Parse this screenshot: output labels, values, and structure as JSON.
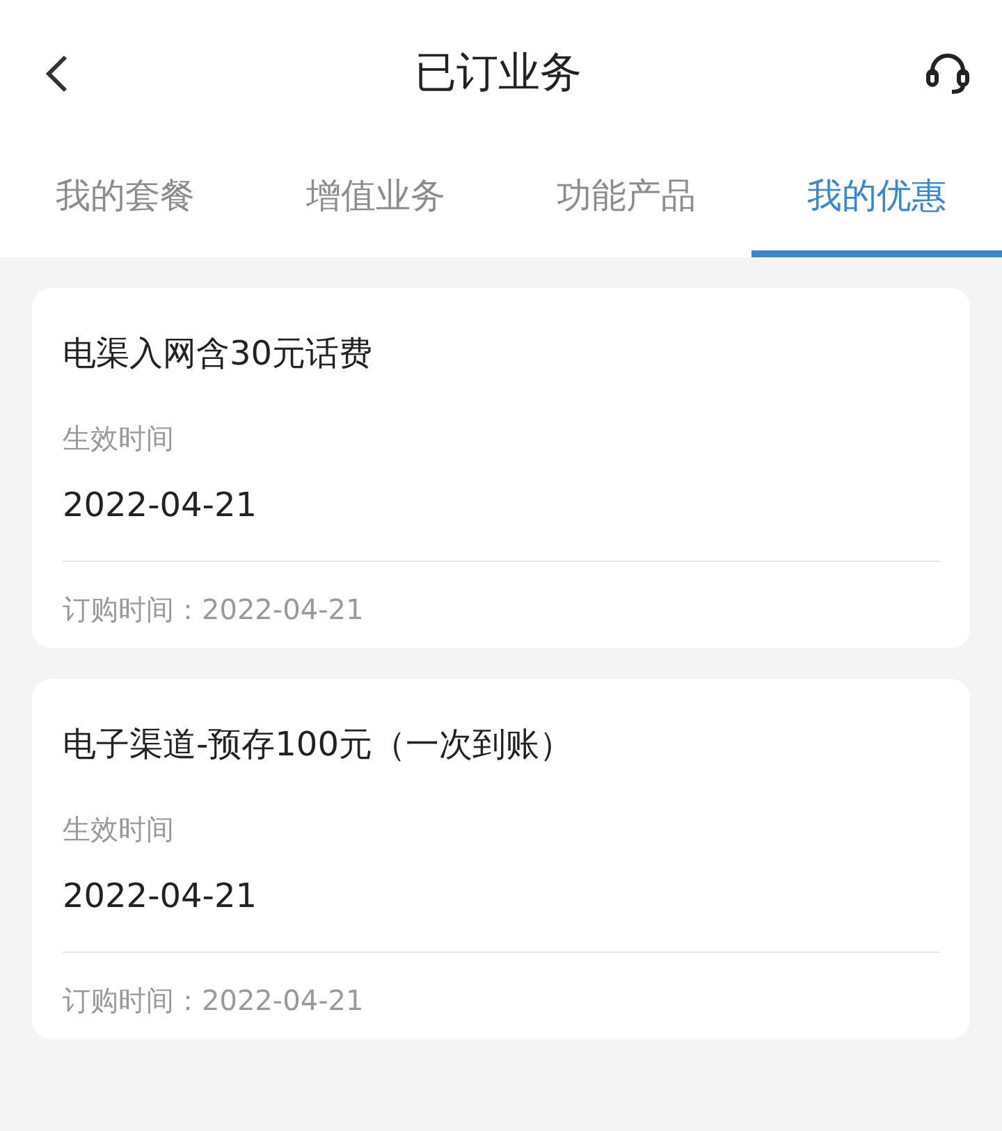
{
  "header": {
    "title": "已订业务"
  },
  "tabs": [
    {
      "label": "我的套餐",
      "selected": false
    },
    {
      "label": "增值业务",
      "selected": false
    },
    {
      "label": "功能产品",
      "selected": false
    },
    {
      "label": "我的优惠",
      "selected": true
    }
  ],
  "offers": [
    {
      "name": "电渠入网含30元话费",
      "effective_label": "生效时间",
      "effective_date": "2022-04-21",
      "order_time": "订购时间：2022-04-21"
    },
    {
      "name": "电子渠道-预存100元（一次到账）",
      "effective_label": "生效时间",
      "effective_date": "2022-04-21",
      "order_time": "订购时间：2022-04-21"
    }
  ]
}
